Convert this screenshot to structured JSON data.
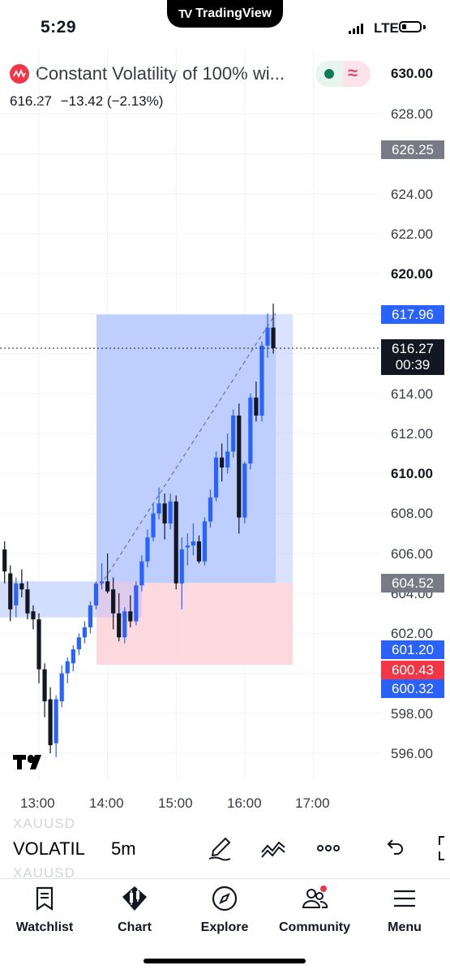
{
  "status_bar": {
    "time": "5:29",
    "brand": "TradingView",
    "network": "LTE"
  },
  "header": {
    "title": "Constant Volatility of 100% wi...",
    "price": "616.27",
    "change": "−13.42 (−2.13%)"
  },
  "price_axis": {
    "labels": [
      "630.00",
      "628.00",
      "624.00",
      "622.00",
      "620.00",
      "614.00",
      "612.00",
      "610.00",
      "608.00",
      "606.00",
      "604.00",
      "602.00",
      "598.00",
      "596.00"
    ],
    "bold_labels": [
      "630.00",
      "620.00",
      "610.00"
    ],
    "tags": {
      "high_line": "626.25",
      "range_top": "617.96",
      "last_price": "616.27",
      "countdown": "00:39",
      "entry": "604.52",
      "low_blue_1": "601.20",
      "low_red": "600.43",
      "low_blue_2": "600.32"
    }
  },
  "time_axis": [
    "13:00",
    "14:00",
    "15:00",
    "16:00",
    "17:00"
  ],
  "toolbar": {
    "symbol": "VOLATIL",
    "ghost_symbol": "XAUUSD",
    "interval": "5m"
  },
  "nav": {
    "items": [
      {
        "label": "Watchlist",
        "icon": "watchlist-icon"
      },
      {
        "label": "Chart",
        "icon": "chart-icon"
      },
      {
        "label": "Explore",
        "icon": "compass-icon"
      },
      {
        "label": "Community",
        "icon": "community-icon"
      },
      {
        "label": "Menu",
        "icon": "menu-icon"
      }
    ]
  },
  "colors": {
    "up": "#2962ff",
    "down": "#131722",
    "profit_zone": "#b3c6ff",
    "loss_zone": "#fbd5da",
    "accent_red": "#f23645"
  },
  "chart_data": {
    "type": "candlestick",
    "symbol": "VOLATIL",
    "interval": "5m",
    "x": [
      "12:30",
      "12:35",
      "12:40",
      "12:45",
      "12:50",
      "12:55",
      "13:00",
      "13:05",
      "13:10",
      "13:15",
      "13:20",
      "13:25",
      "13:30",
      "13:35",
      "13:40",
      "13:45",
      "13:50",
      "13:55",
      "14:00",
      "14:05",
      "14:10",
      "14:15",
      "14:20",
      "14:25",
      "14:30",
      "14:35",
      "14:40",
      "14:45",
      "14:50",
      "14:55",
      "15:00",
      "15:05",
      "15:10",
      "15:15",
      "15:20",
      "15:25",
      "15:30",
      "15:35",
      "15:40",
      "15:45",
      "15:50",
      "15:55",
      "16:00",
      "16:05",
      "16:10",
      "16:15",
      "16:20",
      "16:25"
    ],
    "ohlc": [
      [
        606.2,
        606.6,
        604.5,
        605.1
      ],
      [
        605.0,
        605.4,
        602.6,
        603.2
      ],
      [
        603.4,
        604.8,
        602.8,
        604.5
      ],
      [
        604.5,
        605.2,
        603.8,
        604.2
      ],
      [
        604.2,
        604.6,
        602.7,
        603.0
      ],
      [
        603.1,
        603.4,
        602.2,
        602.7
      ],
      [
        602.7,
        603.0,
        599.5,
        600.2
      ],
      [
        600.2,
        600.5,
        597.8,
        598.6
      ],
      [
        598.7,
        599.3,
        596.0,
        596.4
      ],
      [
        596.5,
        598.9,
        595.8,
        598.7
      ],
      [
        598.6,
        600.4,
        598.3,
        600.0
      ],
      [
        600.0,
        600.8,
        599.5,
        600.6
      ],
      [
        600.5,
        601.4,
        600.1,
        601.2
      ],
      [
        601.2,
        602.0,
        600.9,
        601.8
      ],
      [
        601.8,
        602.6,
        601.5,
        602.3
      ],
      [
        602.3,
        603.6,
        602.0,
        603.4
      ],
      [
        603.4,
        604.6,
        603.2,
        604.5
      ],
      [
        604.5,
        605.5,
        604.2,
        604.6
      ],
      [
        604.6,
        606.0,
        604.0,
        604.1
      ],
      [
        604.2,
        604.8,
        602.2,
        603.0
      ],
      [
        603.0,
        604.0,
        601.6,
        601.8
      ],
      [
        601.8,
        603.3,
        601.5,
        603.1
      ],
      [
        603.1,
        603.9,
        602.3,
        602.6
      ],
      [
        602.6,
        604.6,
        602.4,
        604.4
      ],
      [
        604.4,
        605.9,
        604.1,
        605.6
      ],
      [
        605.6,
        607.2,
        605.3,
        606.8
      ],
      [
        606.8,
        608.5,
        606.6,
        608.0
      ],
      [
        608.0,
        609.3,
        607.7,
        608.5
      ],
      [
        608.5,
        609.0,
        606.7,
        607.5
      ],
      [
        607.5,
        609.0,
        607.2,
        608.6
      ],
      [
        608.6,
        608.9,
        604.2,
        604.5
      ],
      [
        604.5,
        606.8,
        603.2,
        606.2
      ],
      [
        606.3,
        607.0,
        605.4,
        606.4
      ],
      [
        606.4,
        607.5,
        605.9,
        606.6
      ],
      [
        606.6,
        606.9,
        605.5,
        605.6
      ],
      [
        605.6,
        607.8,
        605.4,
        607.6
      ],
      [
        607.6,
        609.2,
        607.3,
        608.8
      ],
      [
        608.8,
        611.1,
        608.6,
        610.8
      ],
      [
        610.8,
        611.5,
        609.6,
        610.3
      ],
      [
        610.3,
        612.0,
        610.0,
        611.1
      ],
      [
        611.1,
        613.2,
        610.8,
        612.9
      ],
      [
        612.9,
        613.5,
        607.0,
        607.8
      ],
      [
        607.8,
        610.6,
        607.5,
        610.5
      ],
      [
        610.5,
        614.0,
        610.2,
        613.8
      ],
      [
        613.8,
        614.6,
        612.6,
        612.9
      ],
      [
        612.9,
        616.6,
        612.6,
        616.4
      ],
      [
        616.4,
        618.0,
        615.8,
        617.3
      ],
      [
        617.3,
        618.5,
        616.0,
        616.27
      ]
    ],
    "ylim": [
      595,
      631
    ],
    "position": {
      "type": "long",
      "entry": 604.52,
      "target": 617.96,
      "stop": 600.43
    }
  }
}
